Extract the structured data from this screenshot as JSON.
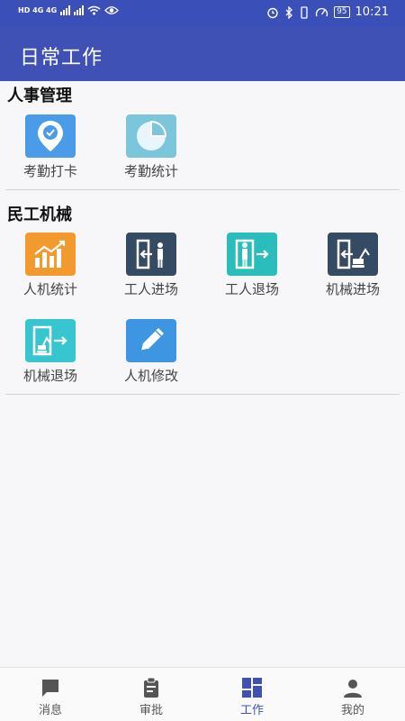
{
  "status_bar": {
    "network_left": "HD 4G 4G",
    "battery": "95",
    "time": "10:21"
  },
  "app_bar": {
    "title": "日常工作"
  },
  "sections": [
    {
      "title": "人事管理",
      "items": [
        {
          "label": "考勤打卡",
          "icon": "location-clock-icon",
          "color": "#4a9be8"
        },
        {
          "label": "考勤统计",
          "icon": "pie-chart-icon",
          "color": "#7cc6dc"
        }
      ]
    },
    {
      "title": "民工机械",
      "items": [
        {
          "label": "人机统计",
          "icon": "bar-trend-icon",
          "color": "#f29a2e"
        },
        {
          "label": "工人进场",
          "icon": "worker-enter-icon",
          "color": "#354a63"
        },
        {
          "label": "工人退场",
          "icon": "worker-exit-icon",
          "color": "#2bbcbc"
        },
        {
          "label": "机械进场",
          "icon": "machine-enter-icon",
          "color": "#354a63"
        },
        {
          "label": "机械退场",
          "icon": "machine-exit-icon",
          "color": "#37c6cf"
        },
        {
          "label": "人机修改",
          "icon": "pencil-icon",
          "color": "#3e96e2"
        }
      ]
    }
  ],
  "tabs": [
    {
      "label": "消息",
      "icon": "chat-icon",
      "active": false
    },
    {
      "label": "审批",
      "icon": "clipboard-icon",
      "active": false
    },
    {
      "label": "工作",
      "icon": "grid-icon",
      "active": true
    },
    {
      "label": "我的",
      "icon": "person-icon",
      "active": false
    }
  ],
  "colors": {
    "primary": "#3f51b5",
    "status_bar": "#3a4fb8",
    "background": "#f7f7fa"
  }
}
